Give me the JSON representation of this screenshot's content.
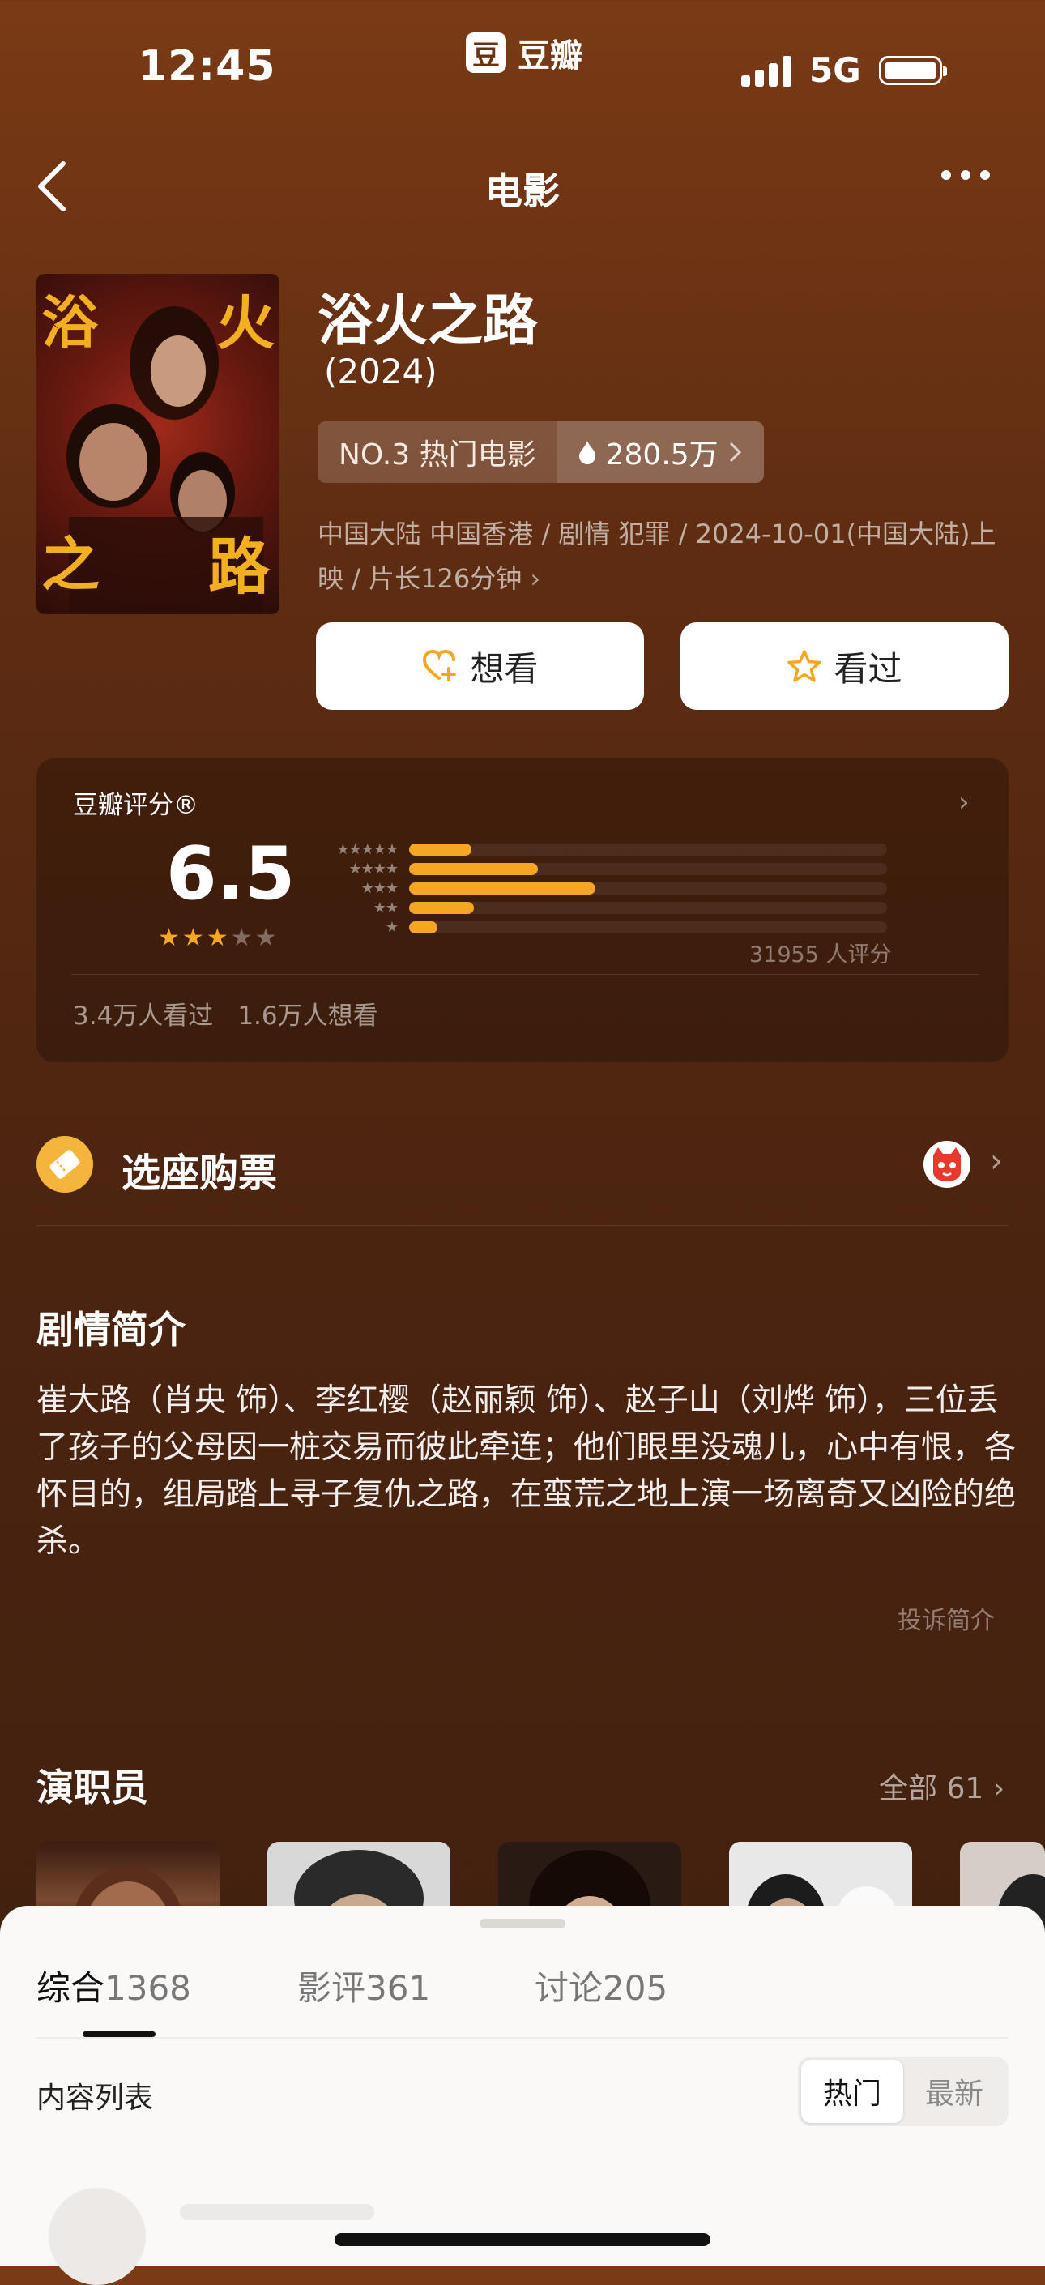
{
  "status_bar": {
    "time": "12:45",
    "app_name": "豆瓣",
    "app_logo_char": "豆",
    "network": "5G"
  },
  "nav": {
    "title": "电影"
  },
  "movie": {
    "title": "浴火之路",
    "year": "(2024)",
    "poster_text": [
      "浴",
      "火",
      "之",
      "路"
    ],
    "rank": "NO.3 热门电影",
    "heat": "280.5万",
    "meta": "中国大陆 中国香港 / 剧情 犯罪 / 2024-10-01(中国大陆)上映 / 片长126分钟"
  },
  "actions": {
    "want": "想看",
    "seen": "看过"
  },
  "rating": {
    "label": "豆瓣评分®",
    "score": "6.5",
    "stars": 3,
    "distribution": [
      {
        "stars": "★★★★★",
        "pct": 13
      },
      {
        "stars": "★★★★",
        "pct": 27
      },
      {
        "stars": "★★★",
        "pct": 39
      },
      {
        "stars": "★★",
        "pct": 13.5
      },
      {
        "stars": "★",
        "pct": 6
      }
    ],
    "count": "31955 人评分",
    "seen": "3.4万人看过",
    "want": "1.6万人想看"
  },
  "tickets": {
    "label": "选座购票"
  },
  "synopsis": {
    "title": "剧情简介",
    "text": "崔大路（肖央 饰）、李红樱（赵丽颖 饰）、赵子山（刘烨 饰），三位丢了孩子的父母因一桩交易而彼此牵连；他们眼里没魂儿，心中有恨，各怀目的，组局踏上寻子复仇之路，在蛮荒之地上演一场离奇又凶险的绝杀。",
    "report": "投诉简介"
  },
  "cast": {
    "title": "演职员",
    "all": "全部 61"
  },
  "sheet": {
    "tabs": [
      {
        "label": "综合",
        "count": "1368"
      },
      {
        "label": "影评",
        "count": "361"
      },
      {
        "label": "讨论",
        "count": "205"
      }
    ],
    "list_label": "内容列表",
    "sort": {
      "hot": "热门",
      "new": "最新"
    }
  },
  "colors": {
    "accent": "#f5a623",
    "background": "#5e2c12"
  }
}
